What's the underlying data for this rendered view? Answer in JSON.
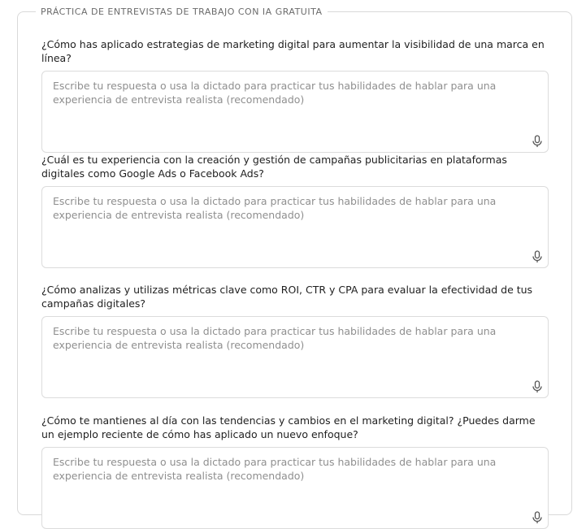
{
  "section": {
    "legend": "PRÁCTICA DE ENTREVISTAS DE TRABAJO CON IA GRATUITA"
  },
  "questions": [
    {
      "text": "¿Cómo has aplicado estrategias de marketing digital para aumentar la visibilidad de una marca en línea?",
      "placeholder": "Escribe tu respuesta o usa la dictado para practicar tus habilidades de hablar para una experiencia de entrevista realista (recomendado)",
      "icon": "microphone-icon"
    },
    {
      "text": "¿Cuál es tu experiencia con la creación y gestión de campañas publicitarias en plataformas digitales como Google Ads o Facebook Ads?",
      "placeholder": "Escribe tu respuesta o usa la dictado para practicar tus habilidades de hablar para una experiencia de entrevista realista (recomendado)",
      "icon": "microphone-icon"
    },
    {
      "text": "¿Cómo analizas y utilizas métricas clave como ROI, CTR y CPA para evaluar la efectividad de tus campañas digitales?",
      "placeholder": "Escribe tu respuesta o usa la dictado para practicar tus habilidades de hablar para una experiencia de entrevista realista (recomendado)",
      "icon": "microphone-icon"
    },
    {
      "text": "¿Cómo te mantienes al día con las tendencias y cambios en el marketing digital? ¿Puedes darme un ejemplo reciente de cómo has aplicado un nuevo enfoque?",
      "placeholder": "Escribe tu respuesta o usa la dictado para practicar tus habilidades de hablar para una experiencia de entrevista realista (recomendado)",
      "icon": "microphone-icon"
    }
  ]
}
